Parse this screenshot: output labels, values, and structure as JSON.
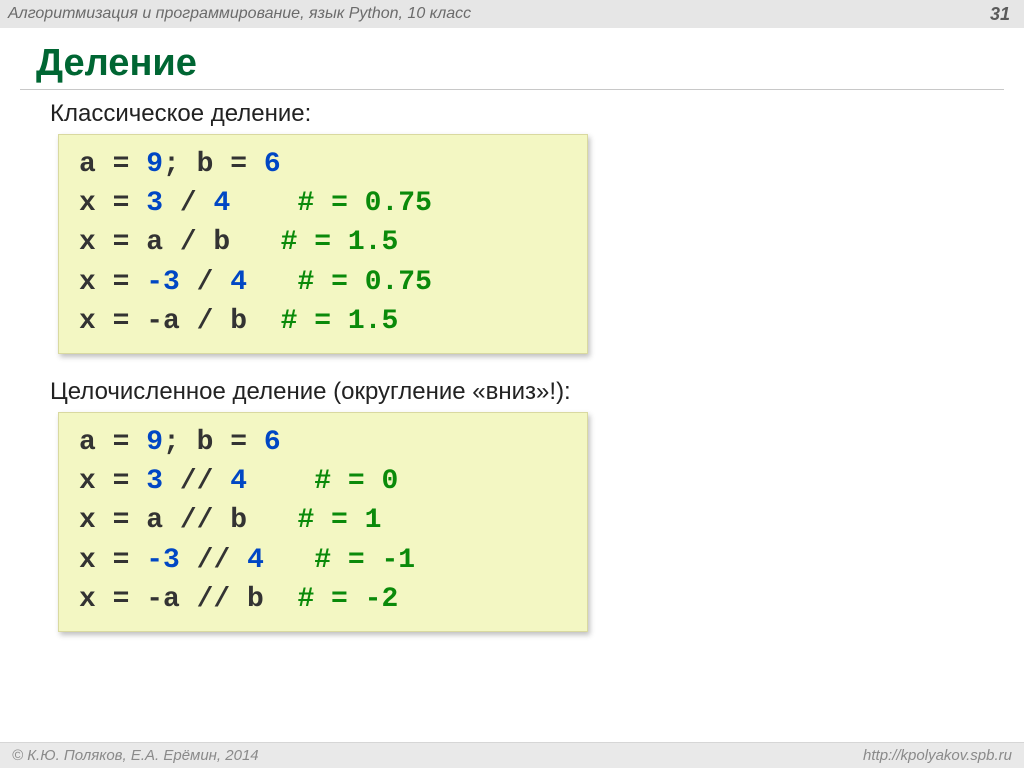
{
  "header": {
    "course": "Алгоритмизация и программирование, язык Python, 10 класс",
    "page_number": "31"
  },
  "title": "Деление",
  "section1": {
    "label": "Классическое деление:",
    "code": [
      [
        {
          "t": "a ",
          "c": ""
        },
        {
          "t": "= ",
          "c": ""
        },
        {
          "t": "9",
          "c": "blue"
        },
        {
          "t": "; b ",
          "c": ""
        },
        {
          "t": "= ",
          "c": ""
        },
        {
          "t": "6",
          "c": "blue"
        }
      ],
      [
        {
          "t": "x ",
          "c": ""
        },
        {
          "t": "= ",
          "c": ""
        },
        {
          "t": "3 ",
          "c": "blue"
        },
        {
          "t": "/ ",
          "c": ""
        },
        {
          "t": "4",
          "c": "blue"
        },
        {
          "t": "    ",
          "c": ""
        },
        {
          "t": "# = 0.75",
          "c": "green"
        }
      ],
      [
        {
          "t": "x ",
          "c": ""
        },
        {
          "t": "= a / b   ",
          "c": ""
        },
        {
          "t": "# = 1.5",
          "c": "green"
        }
      ],
      [
        {
          "t": "x ",
          "c": ""
        },
        {
          "t": "= ",
          "c": ""
        },
        {
          "t": "-3 ",
          "c": "blue"
        },
        {
          "t": "/ ",
          "c": ""
        },
        {
          "t": "4",
          "c": "blue"
        },
        {
          "t": "   ",
          "c": ""
        },
        {
          "t": "# = 0.75",
          "c": "green"
        }
      ],
      [
        {
          "t": "x ",
          "c": ""
        },
        {
          "t": "= -a / b  ",
          "c": ""
        },
        {
          "t": "# = 1.5",
          "c": "green"
        }
      ]
    ]
  },
  "section2": {
    "label": "Целочисленное деление (округление «вниз»!):",
    "code": [
      [
        {
          "t": "a ",
          "c": ""
        },
        {
          "t": "= ",
          "c": ""
        },
        {
          "t": "9",
          "c": "blue"
        },
        {
          "t": "; b ",
          "c": ""
        },
        {
          "t": "= ",
          "c": ""
        },
        {
          "t": "6",
          "c": "blue"
        }
      ],
      [
        {
          "t": "x ",
          "c": ""
        },
        {
          "t": "= ",
          "c": ""
        },
        {
          "t": "3 ",
          "c": "blue"
        },
        {
          "t": "// ",
          "c": ""
        },
        {
          "t": "4",
          "c": "blue"
        },
        {
          "t": "    ",
          "c": ""
        },
        {
          "t": "# = 0",
          "c": "green"
        }
      ],
      [
        {
          "t": "x ",
          "c": ""
        },
        {
          "t": "= a // b   ",
          "c": ""
        },
        {
          "t": "# = 1",
          "c": "green"
        }
      ],
      [
        {
          "t": "x ",
          "c": ""
        },
        {
          "t": "= ",
          "c": ""
        },
        {
          "t": "-3 ",
          "c": "blue"
        },
        {
          "t": "// ",
          "c": ""
        },
        {
          "t": "4",
          "c": "blue"
        },
        {
          "t": "   ",
          "c": ""
        },
        {
          "t": "# = -1",
          "c": "green"
        }
      ],
      [
        {
          "t": "x ",
          "c": ""
        },
        {
          "t": "= -a // b  ",
          "c": ""
        },
        {
          "t": "# = -2",
          "c": "green"
        }
      ]
    ]
  },
  "footer": {
    "copyright": "© К.Ю. Поляков, Е.А. Ерёмин, 2014",
    "url": "http://kpolyakov.spb.ru"
  }
}
